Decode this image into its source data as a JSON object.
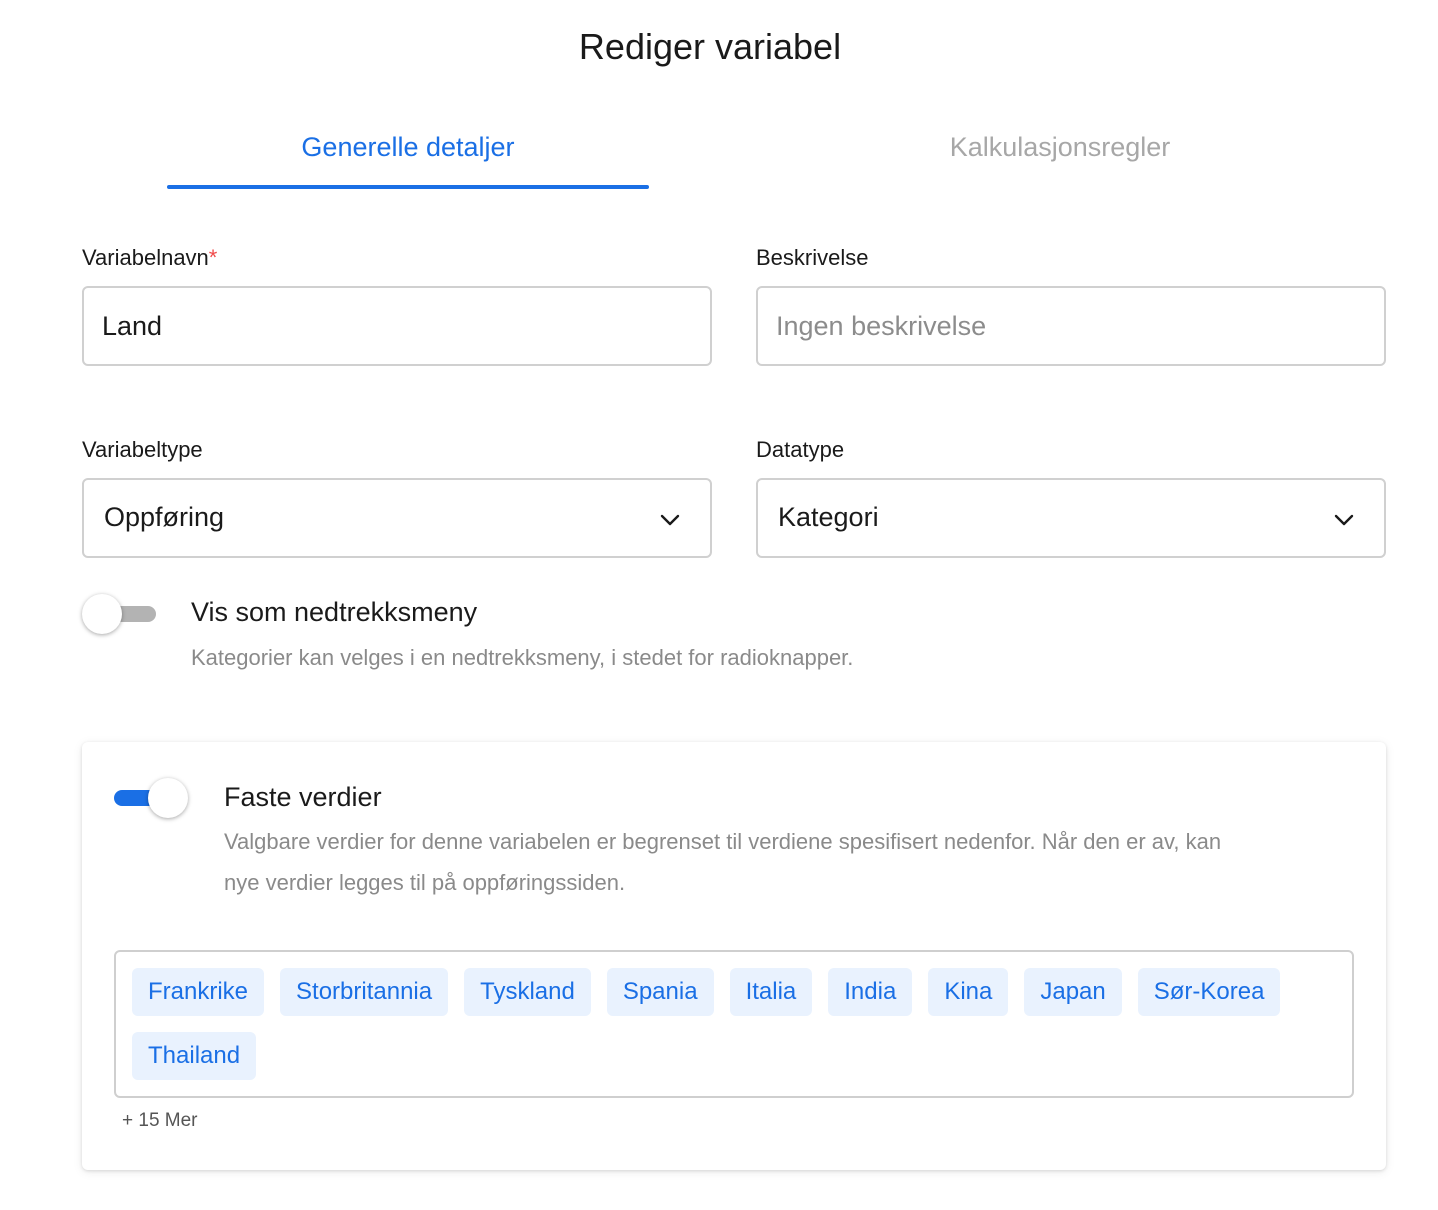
{
  "dialog": {
    "title": "Rediger variabel"
  },
  "tabs": [
    {
      "label": "Generelle detaljer",
      "active": true
    },
    {
      "label": "Kalkulasjonsregler",
      "active": false
    }
  ],
  "fields": {
    "variable_name": {
      "label": "Variabelnavn",
      "required_marker": "*",
      "value": "Land"
    },
    "description": {
      "label": "Beskrivelse",
      "value": "",
      "placeholder": "Ingen beskrivelse"
    },
    "variable_type": {
      "label": "Variabeltype",
      "selected": "Oppføring",
      "icon": "chevron-down-icon"
    },
    "data_type": {
      "label": "Datatype",
      "selected": "Kategori",
      "icon": "chevron-down-icon"
    }
  },
  "dropdown_toggle": {
    "label": "Vis som nedtrekksmeny",
    "description": "Kategorier kan velges i en nedtrekksmeny, i stedet for radioknapper.",
    "enabled": false
  },
  "fixed_values": {
    "label": "Faste verdier",
    "description_line1": "Valgbare verdier for denne variabelen er begrenset til verdiene spesifisert nedenfor. Når den er av, kan",
    "description_line2": "nye verdier legges til på oppføringssiden.",
    "enabled": true,
    "values": [
      "Frankrike",
      "Storbritannia",
      "Tyskland",
      "Spania",
      "Italia",
      "India",
      "Kina",
      "Japan",
      "Sør-Korea",
      "Thailand"
    ],
    "more_label": "+ 15 Mer"
  },
  "colors": {
    "accent": "#1a6fe5",
    "chip_background": "#e9f2fe",
    "required": "#f04a4a",
    "toggle_off": "#b3b3b3",
    "muted_text": "#8a8a8a"
  }
}
